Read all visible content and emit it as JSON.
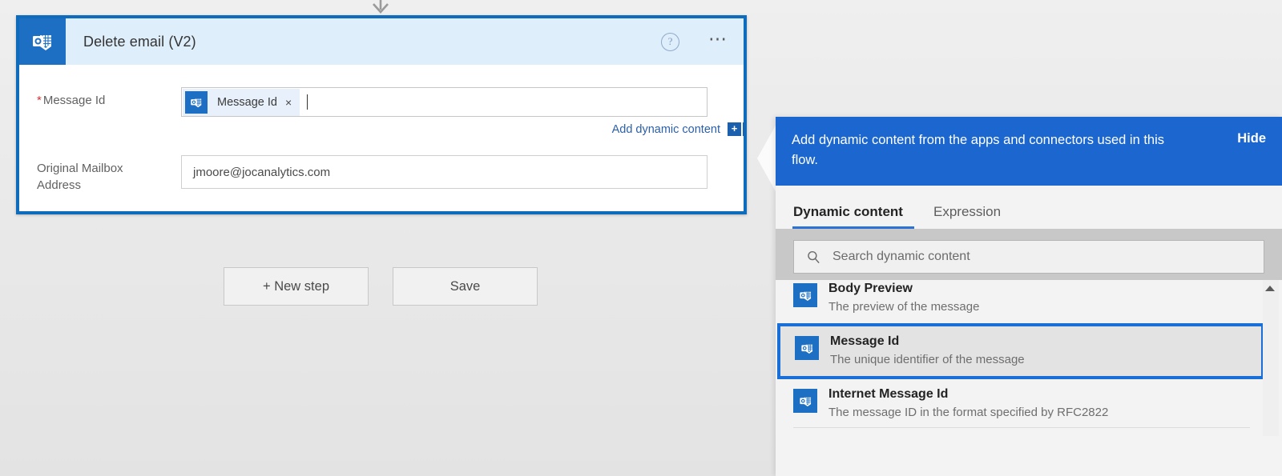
{
  "card": {
    "title": "Delete email (V2)",
    "icon": "outlook-icon",
    "help_icon": "help-circle-icon",
    "more_icon": "ellipsis-icon",
    "accent_color": "#0f6cbd",
    "header_bg": "#dfeefb",
    "fields": [
      {
        "label": "Message Id",
        "required": true,
        "required_marker": "*",
        "token": {
          "label": "Message Id",
          "remove_label": "×",
          "icon": "outlook-icon"
        }
      },
      {
        "label_line1": "Original Mailbox",
        "label_line2": "Address",
        "required": false,
        "value": "jmoore@jocanalytics.com"
      }
    ],
    "add_dynamic_content": {
      "label": "Add dynamic content",
      "plus_label": "+",
      "icon": "plus-square-icon",
      "color": "#2b5fa8"
    }
  },
  "buttons": {
    "new_step": "+ New step",
    "save": "Save"
  },
  "dynamic_content_panel": {
    "banner": {
      "text": "Add dynamic content from the apps and connectors used in this flow.",
      "hide_label": "Hide",
      "bg_color": "#1b66cf"
    },
    "tabs": [
      {
        "label": "Dynamic content",
        "active": true
      },
      {
        "label": "Expression",
        "active": false
      }
    ],
    "search": {
      "placeholder": "Search dynamic content",
      "value": "",
      "icon": "search-icon"
    },
    "items": [
      {
        "title": "Body Preview",
        "description": "The preview of the message",
        "icon": "outlook-icon",
        "selected": false
      },
      {
        "title": "Message Id",
        "description": "The unique identifier of the message",
        "icon": "outlook-icon",
        "selected": true
      },
      {
        "title": "Internet Message Id",
        "description": "The message ID in the format specified by RFC2822",
        "icon": "outlook-icon",
        "selected": false
      }
    ],
    "scrollbar": {
      "up_arrow_icon": "chevron-up-icon"
    },
    "selection_color": "#1a6ed8"
  }
}
